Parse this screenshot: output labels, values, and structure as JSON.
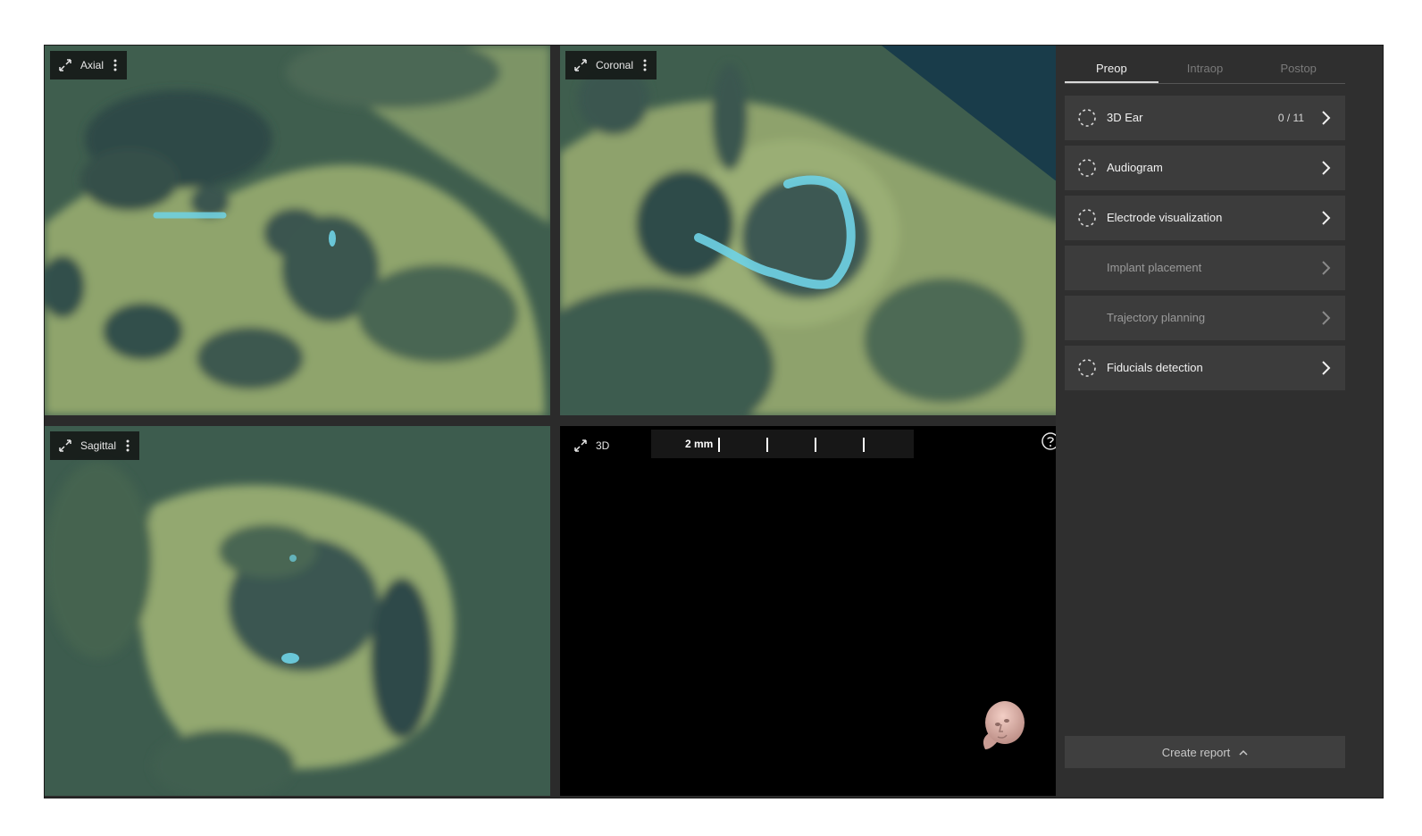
{
  "viewports": {
    "axial": {
      "title": "Axial"
    },
    "coronal": {
      "title": "Coronal"
    },
    "sagittal": {
      "title": "Sagittal"
    },
    "three_d": {
      "title": "3D",
      "scale_label": "2 mm"
    }
  },
  "icons": {
    "expand": "expand-icon",
    "more": "kebab-menu-icon",
    "help": "help-circle-icon",
    "step_status": "dashed-circle-icon",
    "chevron": "chevron-right-icon",
    "head": "head-orientation-icon"
  },
  "panel": {
    "tabs": [
      {
        "label": "Preop",
        "active": true
      },
      {
        "label": "Intraop",
        "active": false
      },
      {
        "label": "Postop",
        "active": false
      }
    ],
    "steps": [
      {
        "label": "3D Ear",
        "count": "0 / 11",
        "enabled": true
      },
      {
        "label": "Audiogram",
        "count": "",
        "enabled": true
      },
      {
        "label": "Electrode visualization",
        "count": "",
        "enabled": true
      },
      {
        "label": "Implant placement",
        "count": "",
        "enabled": false
      },
      {
        "label": "Trajectory planning",
        "count": "",
        "enabled": false
      },
      {
        "label": "Fiducials detection",
        "count": "",
        "enabled": true
      }
    ],
    "report_label": "Create report"
  },
  "colors": {
    "scan_bone": "#a7b87a",
    "scan_air": "#2f4a47",
    "electrode": "#6fd3e6",
    "panel_bg": "#2f2f2f",
    "step_bg": "#3c3c3c"
  }
}
